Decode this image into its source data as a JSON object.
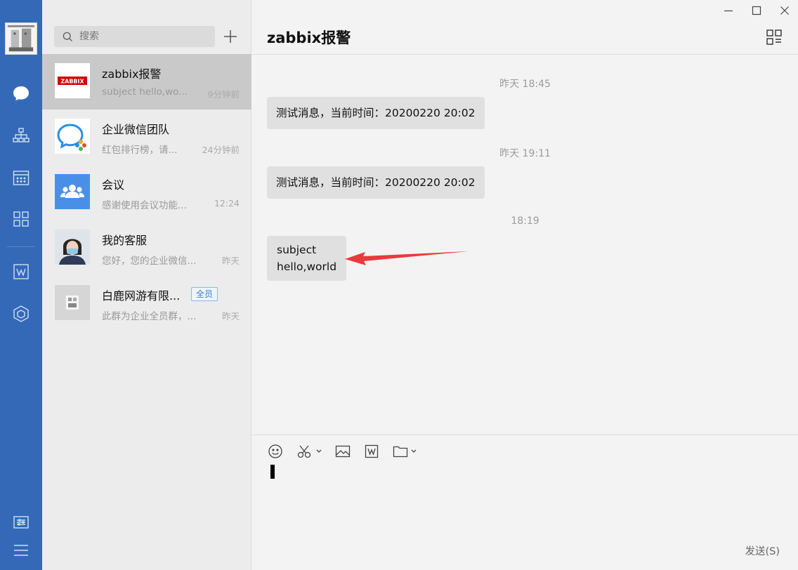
{
  "rail": {
    "icons": [
      "chat-icon",
      "org-chart-icon",
      "calendar-icon",
      "apps-icon",
      "doc-icon",
      "hexagon-icon",
      "settings-icon",
      "menu-icon"
    ],
    "active": "chat-icon",
    "accent": "#3369b7"
  },
  "search": {
    "placeholder": "搜索"
  },
  "conversations": [
    {
      "name": "zabbix报警",
      "preview": "subject hello,wo...",
      "time": "9分钟前",
      "avatar": "zabbix-logo"
    },
    {
      "name": "企业微信团队",
      "preview": "红包排行榜，请...",
      "time": "24分钟前",
      "avatar": "wecom-logo"
    },
    {
      "name": "会议",
      "preview": "感谢使用会议功能...",
      "time": "12:24",
      "avatar": "meeting-icon"
    },
    {
      "name": "我的客服",
      "preview": "您好，您的企业微信...",
      "time": "昨天",
      "avatar": "agent-photo"
    },
    {
      "name": "白鹿网游有限...",
      "preview": "此群为企业全员群，...",
      "time": "昨天",
      "avatar": "group-thumb",
      "badge": "全员"
    }
  ],
  "chat": {
    "title": "zabbix报警",
    "messages": [
      {
        "timestamp": "昨天 18:45",
        "text": "测试消息，当前时间：20200220 20:02"
      },
      {
        "timestamp": "昨天 19:11",
        "text": "测试消息，当前时间：20200220 20:02"
      },
      {
        "timestamp": "18:19",
        "line1": "subject",
        "line2": "hello,world"
      }
    ],
    "send_label": "发送(S)",
    "annotation_color": "#e83a3a"
  },
  "avatars": {
    "zabbix_text": "ZABBIX",
    "zabbix_color": "#d40000"
  }
}
